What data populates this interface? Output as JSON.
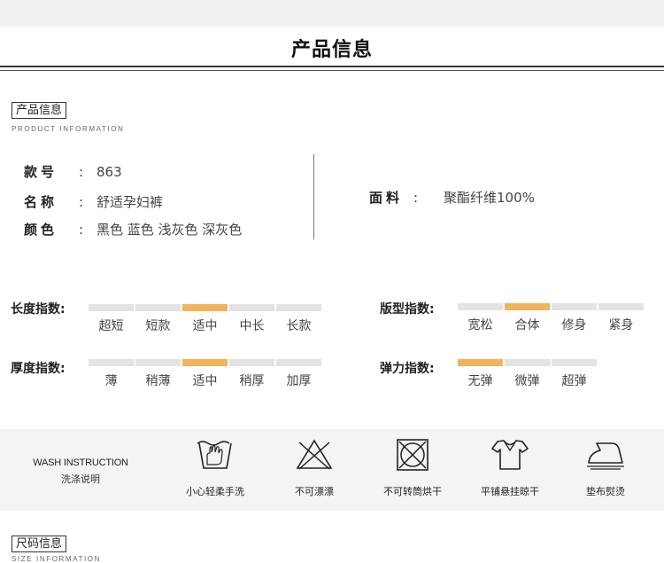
{
  "header": {
    "title": "产品信息"
  },
  "product_section": {
    "label": "产品信息",
    "subtitle": "PRODUCT INFORMATION"
  },
  "info": {
    "model": {
      "key": "款号",
      "colon": ":",
      "value": "863"
    },
    "name": {
      "key": "名称",
      "colon": ":",
      "value": "舒适孕妇裤"
    },
    "color": {
      "key": "颜色",
      "colon": ":",
      "value": "黑色 蓝色 浅灰色 深灰色"
    },
    "fabric": {
      "key": "面料",
      "colon": ":",
      "value": "聚酯纤维100%"
    }
  },
  "scales": {
    "length": {
      "title": "长度指数:",
      "options": [
        "超短",
        "短款",
        "适中",
        "中长",
        "长款"
      ],
      "selected_index": 2
    },
    "fit": {
      "title": "版型指数:",
      "options": [
        "宽松",
        "合体",
        "修身",
        "紧身"
      ],
      "selected_index": 1
    },
    "thickness": {
      "title": "厚度指数:",
      "options": [
        "薄",
        "稍薄",
        "适中",
        "稍厚",
        "加厚"
      ],
      "selected_index": 2
    },
    "elasticity": {
      "title": "弹力指数:",
      "options": [
        "无弹",
        "微弹",
        "超弹"
      ],
      "selected_index": 0
    }
  },
  "wash": {
    "title_en": "WASH INSTRUCTION",
    "title_cn": "洗涤说明",
    "items": [
      {
        "label": "小心轻柔手洗",
        "icon": "hand-wash-icon"
      },
      {
        "label": "不可漂漂",
        "icon": "no-bleach-icon"
      },
      {
        "label": "不可转筒烘干",
        "icon": "no-tumble-dry-icon"
      },
      {
        "label": "平铺悬挂晾干",
        "icon": "flat-dry-icon"
      },
      {
        "label": "垫布熨烫",
        "icon": "iron-with-cloth-icon"
      }
    ]
  },
  "size_section": {
    "label": "尺码信息",
    "subtitle": "SIZE INFORMATION"
  },
  "colors": {
    "accent": "#f0b45c",
    "bar_inactive": "#e3e3e3",
    "wash_bg": "#f4f4f4"
  }
}
